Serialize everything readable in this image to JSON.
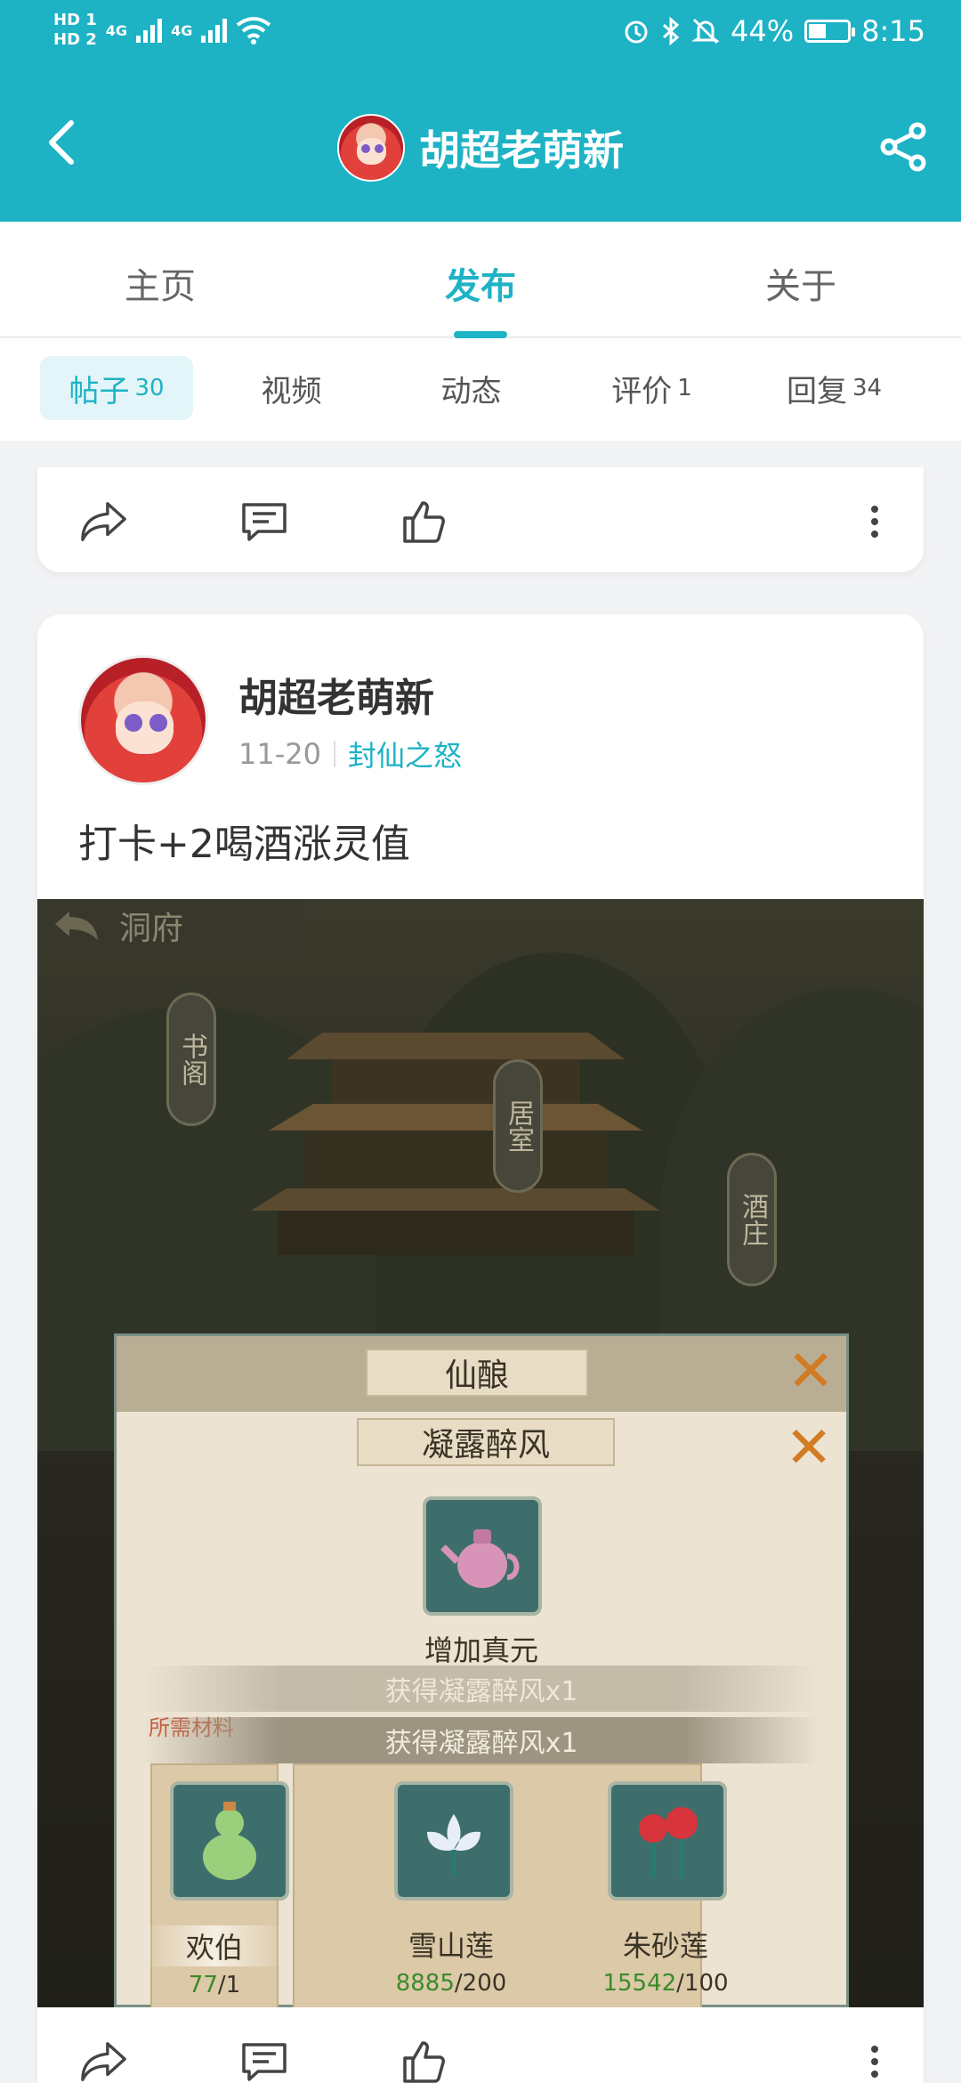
{
  "status": {
    "hd1": "HD 1",
    "hd2": "HD 2",
    "net1": "4G",
    "net2": "4G",
    "battery_pct": "44%",
    "battery_level": 0.44,
    "time": "8:15"
  },
  "header": {
    "title": "胡超老萌新"
  },
  "tabs": [
    {
      "label": "主页"
    },
    {
      "label": "发布"
    },
    {
      "label": "关于"
    }
  ],
  "subtabs": [
    {
      "label": "帖子",
      "count": "30"
    },
    {
      "label": "视频",
      "count": ""
    },
    {
      "label": "动态",
      "count": ""
    },
    {
      "label": "评价",
      "count": "1"
    },
    {
      "label": "回复",
      "count": "34"
    }
  ],
  "post": {
    "author": "胡超老萌新",
    "date": "11-20",
    "game": "封仙之怒",
    "text": "打卡+2喝酒涨灵值"
  },
  "screenshot": {
    "nav_title": "洞府",
    "sign_left": "书阁",
    "sign_mid": "居室",
    "sign_right": "酒庄",
    "dialog_header": "仙酿",
    "item_title": "凝露醉风",
    "item_effect": "增加真元",
    "banner_ghost": "获得凝露醉风x1",
    "banner": "获得凝露醉风x1",
    "materials_label": "所需材料",
    "materials": [
      {
        "name": "欢伯",
        "have": "77",
        "need": "/1"
      },
      {
        "name": "雪山莲",
        "have": "8885",
        "need": "/200"
      },
      {
        "name": "朱砂莲",
        "have": "15542",
        "need": "/100"
      }
    ]
  },
  "colors": {
    "accent": "#1db3c5",
    "background": "#f2f3f5"
  },
  "icons": [
    "back-icon",
    "share-icon",
    "forward-icon",
    "comment-icon",
    "like-icon",
    "more-icon"
  ]
}
